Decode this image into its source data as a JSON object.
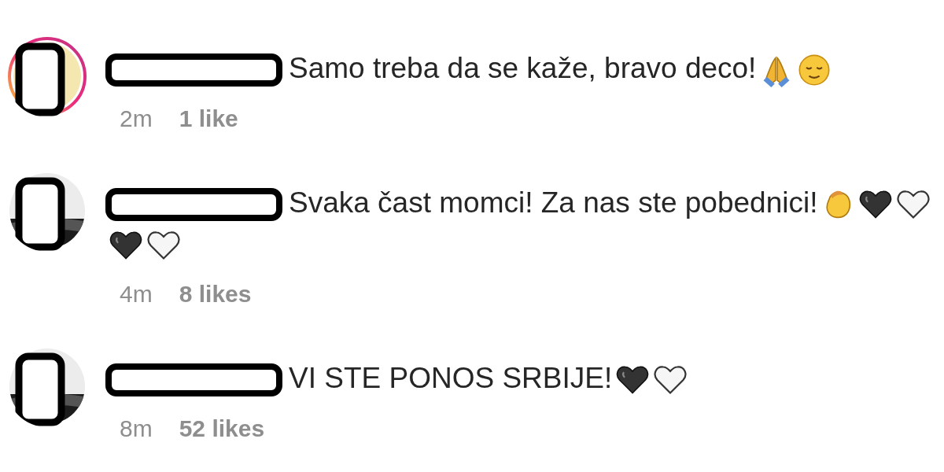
{
  "comments": [
    {
      "avatar": {
        "story_ring": true,
        "kind": "blank"
      },
      "text": "Samo treba da se kaže, bravo deco!",
      "emojis": [
        {
          "kind": "pray"
        },
        {
          "kind": "relieved"
        }
      ],
      "time": "2m",
      "likes": "1 like"
    },
    {
      "avatar": {
        "story_ring": false,
        "kind": "picture"
      },
      "text": "Svaka čast momci! Za nas ste pobednici!",
      "emojis": [
        {
          "kind": "clap"
        },
        {
          "kind": "black-heart"
        },
        {
          "kind": "white-heart"
        },
        {
          "kind": "black-heart"
        },
        {
          "kind": "white-heart"
        }
      ],
      "time": "4m",
      "likes": "8 likes"
    },
    {
      "avatar": {
        "story_ring": false,
        "kind": "picture"
      },
      "text": "VI STE PONOS SRBIJE!",
      "emojis": [
        {
          "kind": "black-heart"
        },
        {
          "kind": "white-heart"
        }
      ],
      "time": "8m",
      "likes": "52 likes"
    }
  ]
}
